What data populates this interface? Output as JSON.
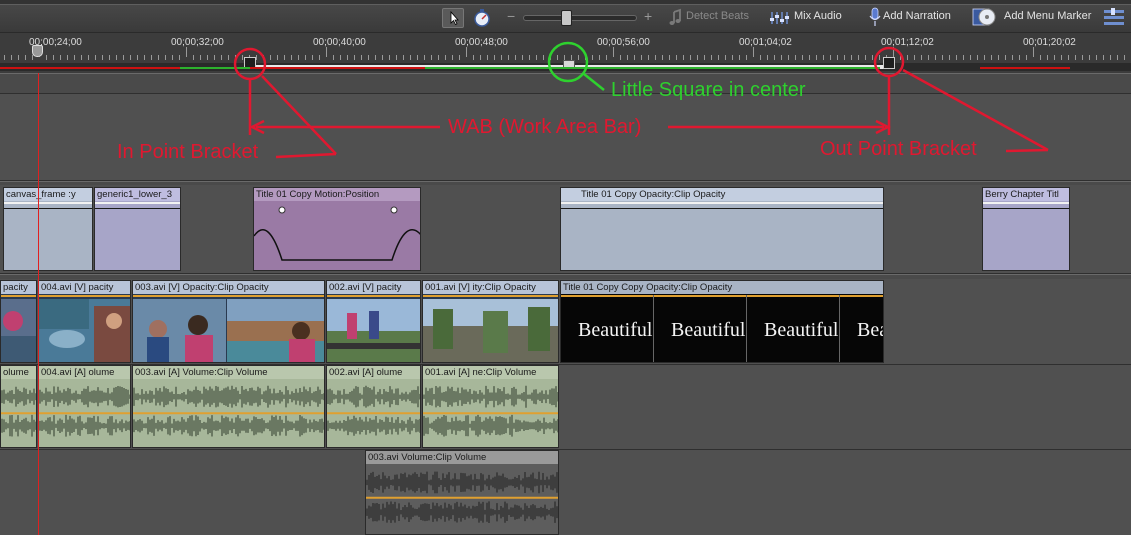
{
  "toolbar": {
    "detect_beats_label": "Detect Beats",
    "mix_audio_label": "Mix Audio",
    "add_narration_label": "Add Narration",
    "add_menu_marker_label": "Add Menu Marker",
    "zoom_minus": "−",
    "zoom_plus": "+"
  },
  "ruler": {
    "timecodes": [
      "00;00;24;00",
      "00;00;32;00",
      "00;00;40;00",
      "00;00;48;00",
      "00;00;56;00",
      "00;01;04;02",
      "00;01;12;02",
      "00;01;20;02"
    ]
  },
  "annotations": {
    "center_square": "Little Square in center",
    "wab": "WAB (Work Area Bar)",
    "in_point": "In Point Bracket",
    "out_point": "Out Point Bracket"
  },
  "track1": {
    "clip_canvas": "canvas_frame :y",
    "clip_lower": "generic1_lower_3",
    "clip_title01": "Title 01 Copy  Motion:Position",
    "clip_titlecc": "Title 01 Copy  Opacity:Clip Opacity",
    "clip_berry": "Berry Chapter Titl"
  },
  "video_track": {
    "clip_a": "pacity",
    "clip_b": "004.avi [V]  pacity",
    "clip_c": "003.avi [V]  Opacity:Clip Opacity",
    "clip_d": "002.avi [V]  pacity",
    "clip_e": "001.avi [V]  ity:Clip Opacity",
    "clip_f": "Title 01 Copy Copy  Opacity:Clip Opacity",
    "beautiful_text": "Beautiful",
    "beautiful_partial": "Beau"
  },
  "audio_track": {
    "clip_a": "olume",
    "clip_b": "004.avi [A]  olume",
    "clip_c": "003.avi [A]  Volume:Clip Volume",
    "clip_d": "002.avi [A]  olume",
    "clip_e": "001.avi [A]  ne:Clip Volume"
  },
  "audio_track2": {
    "clip_a": "003.avi  Volume:Clip Volume"
  },
  "colors": {
    "annotation_red": "#e01830",
    "annotation_green": "#2ed12e",
    "wab": "#e8e8e8",
    "playhead": "#e02020"
  }
}
